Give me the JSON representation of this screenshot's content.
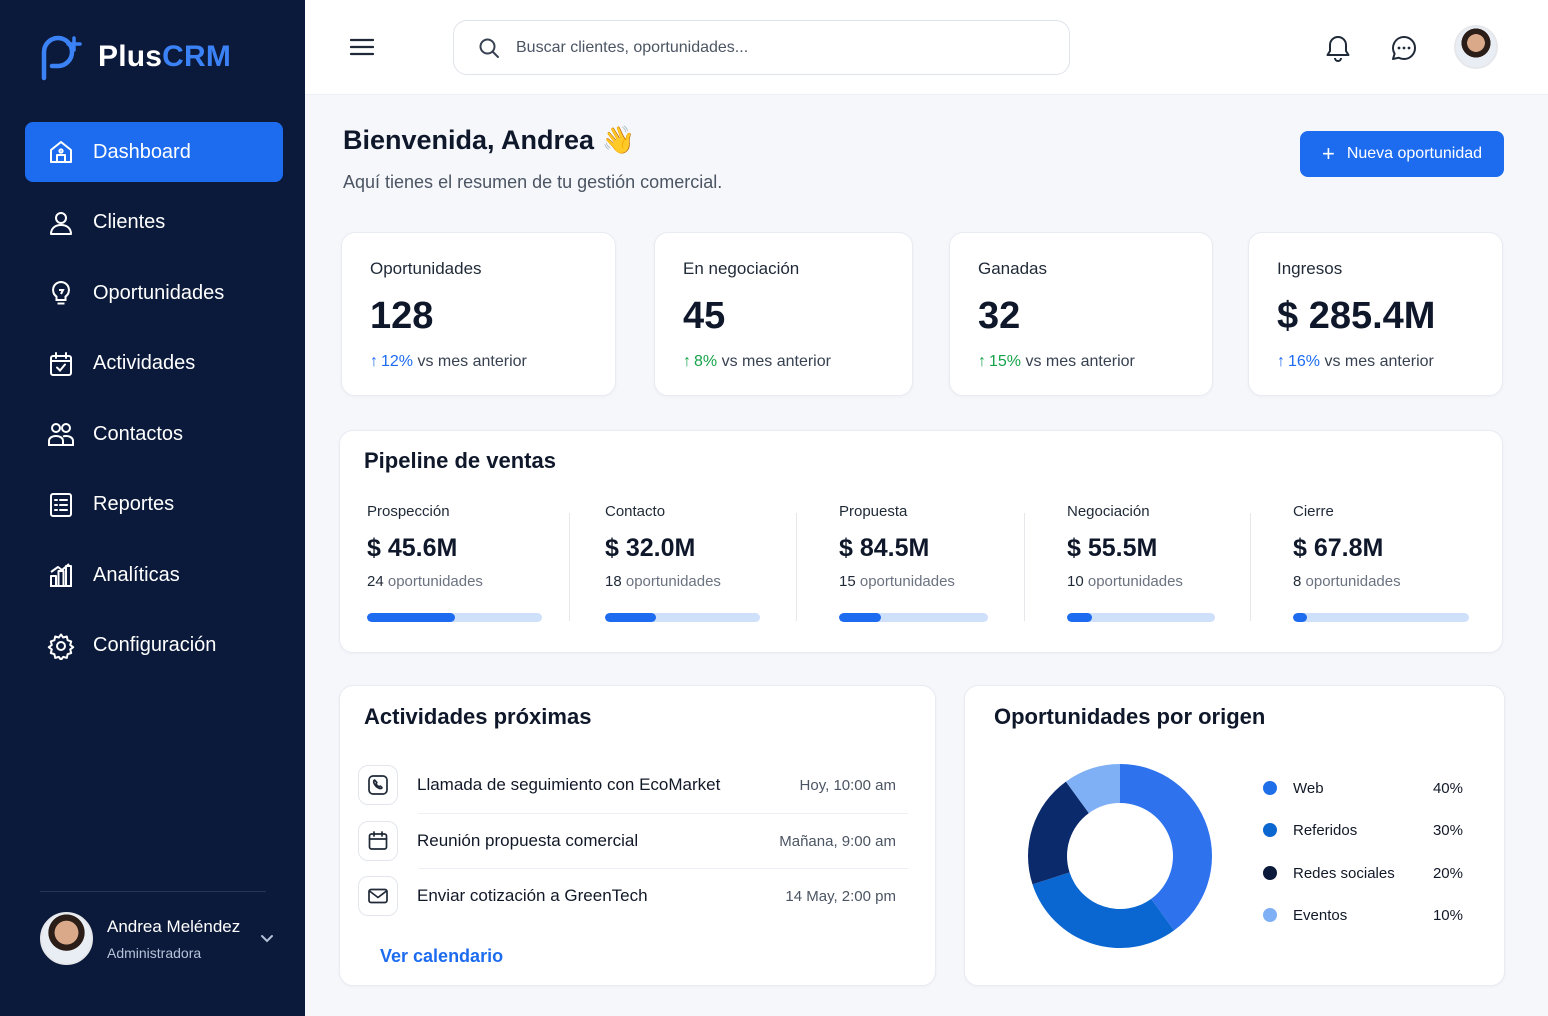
{
  "brand": {
    "prefix": "Plus",
    "accent": "CRM",
    "color": "#1d6cf0"
  },
  "sidebar": {
    "items": [
      {
        "label": "Dashboard",
        "icon": "home-icon",
        "active": true
      },
      {
        "label": "Clientes",
        "icon": "user-icon"
      },
      {
        "label": "Oportunidades",
        "icon": "lightbulb-icon"
      },
      {
        "label": "Actividades",
        "icon": "calendar-check-icon"
      },
      {
        "label": "Contactos",
        "icon": "users-icon"
      },
      {
        "label": "Reportes",
        "icon": "report-icon"
      },
      {
        "label": "Analíticas",
        "icon": "analytics-icon"
      },
      {
        "label": "Configuración",
        "icon": "gear-icon"
      }
    ],
    "profile": {
      "name": "Andrea Meléndez",
      "role": "Administradora"
    }
  },
  "header": {
    "search_placeholder": "Buscar clientes, oportunidades...",
    "icons": [
      "menu-icon",
      "search-icon",
      "bell-icon",
      "chat-icon",
      "avatar"
    ]
  },
  "welcome": {
    "title": "Bienvenida, Andrea 👋",
    "subtitle": "Aquí tienes el resumen de tu gestión comercial.",
    "new_button": "Nueva oportunidad"
  },
  "kpis": [
    {
      "label": "Oportunidades",
      "value": "128",
      "delta": "12%",
      "suffix": "vs mes anterior",
      "color": "#1d6cf0"
    },
    {
      "label": "En negociación",
      "value": "45",
      "delta": "8%",
      "suffix": "vs mes anterior",
      "color": "#16a34a"
    },
    {
      "label": "Ganadas",
      "value": "32",
      "delta": "15%",
      "suffix": "vs mes anterior",
      "color": "#16a34a"
    },
    {
      "label": "Ingresos",
      "value": "$ 285.4M",
      "delta": "16%",
      "suffix": "vs mes anterior",
      "color": "#1d6cf0"
    }
  ],
  "pipeline": {
    "title": "Pipeline de ventas",
    "stages": [
      {
        "label": "Prospección",
        "value": "$ 45.6M",
        "count": "24",
        "count_label": "oportunidades",
        "progress": 0.5
      },
      {
        "label": "Contacto",
        "value": "$ 32.0M",
        "count": "18",
        "count_label": "oportunidades",
        "progress": 0.33
      },
      {
        "label": "Propuesta",
        "value": "$ 84.5M",
        "count": "15",
        "count_label": "oportunidades",
        "progress": 0.28
      },
      {
        "label": "Negociación",
        "value": "$ 55.5M",
        "count": "10",
        "count_label": "oportunidades",
        "progress": 0.17
      },
      {
        "label": "Cierre",
        "value": "$ 67.8M",
        "count": "8",
        "count_label": "oportunidades",
        "progress": 0.08
      }
    ]
  },
  "activities": {
    "title": "Actividades próximas",
    "items": [
      {
        "title": "Llamada de seguimiento con EcoMarket",
        "time": "Hoy, 10:00 am",
        "icon": "phone-icon"
      },
      {
        "title": "Reunión propuesta comercial",
        "time": "Mañana, 9:00 am",
        "icon": "calendar-icon"
      },
      {
        "title": "Enviar cotización a GreenTech",
        "time": "14 May, 2:00 pm",
        "icon": "mail-icon"
      }
    ],
    "link": "Ver calendario"
  },
  "origin": {
    "title": "Oportunidades por origen",
    "legend": [
      {
        "name": "Web",
        "value": "40%",
        "color": "#1f6fe8"
      },
      {
        "name": "Referidos",
        "value": "30%",
        "color": "#0b67d0"
      },
      {
        "name": "Redes sociales",
        "value": "20%",
        "color": "#0b1a3a"
      },
      {
        "name": "Eventos",
        "value": "10%",
        "color": "#7fb0f5"
      }
    ]
  },
  "chart_data": {
    "type": "pie",
    "categories": [
      "Web",
      "Referidos",
      "Redes sociales",
      "Eventos"
    ],
    "values": [
      40,
      30,
      20,
      10
    ],
    "colors": [
      "#2f72ee",
      "#0a67d1",
      "#0a2a6b",
      "#7fb0f5"
    ],
    "title": "Oportunidades por origen",
    "style": "donut"
  }
}
